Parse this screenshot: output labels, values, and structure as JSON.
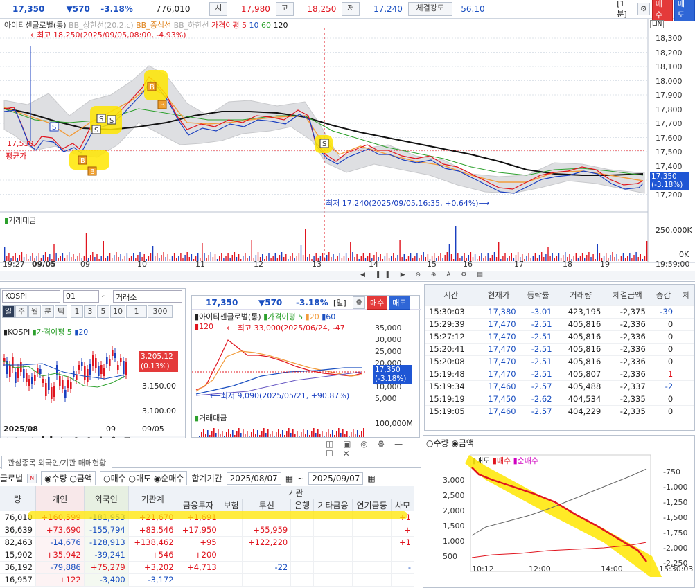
{
  "top": {
    "price": "17,350",
    "change": "▼570",
    "pct": "-3.18%",
    "volume": "776,010",
    "open_label": "시",
    "open": "17,980",
    "high_label": "고",
    "high": "18,250",
    "low_label": "저",
    "low": "17,240",
    "strength_label": "체결강도",
    "strength": "56.10",
    "period": "[1분]",
    "buy": "매수",
    "sell": "매도"
  },
  "main_chart": {
    "name": "아이티센글로벌(통)",
    "legend": [
      "BB_상한선(20,2,c)",
      "BB_중심선",
      "BB_하한선",
      "가격이평 5",
      "10",
      "60",
      "120"
    ],
    "high_note": "최고 18,250(2025/09/05,08:00, -4.93%)",
    "low_note": "최저 17,240(2025/09/05,16:35, +0.64%)",
    "avg_value": "17,530",
    "avg_label": "평균가",
    "current_price": "17,350",
    "current_pct": "(-3.18%)",
    "y_ticks": [
      "18,300",
      "18,200",
      "18,100",
      "18,000",
      "17,900",
      "17,800",
      "17,700",
      "17,600",
      "17,500",
      "17,400",
      "17,300",
      "17,200"
    ],
    "volume_label": "거래대금",
    "vol_ticks": [
      "250,000K",
      "0K"
    ],
    "x_ticks": [
      "19:27",
      "09/05",
      "09",
      "10",
      "11",
      "12",
      "13",
      "14",
      "15",
      "16",
      "17",
      "18",
      "19",
      "19:59:00"
    ],
    "toolbar_icons": [
      "scroll-left-icon",
      "pause-icon",
      "scroll-right-icon"
    ],
    "right_icons": [
      "LIN",
      "LN",
      "R"
    ]
  },
  "kospi": {
    "code": "KOSPI",
    "num": "01",
    "market": "거래소",
    "periods": [
      "일",
      "주",
      "월",
      "분",
      "틱"
    ],
    "nums": [
      "1",
      "3",
      "5",
      "10"
    ],
    "sel": "1",
    "count": "300",
    "name": "KOSPI",
    "legend": [
      "가격이평 5",
      "20"
    ],
    "value": "3,205.12",
    "pct": "(0.13%)",
    "y_ticks": [
      "3,150.00",
      "3,100.00"
    ],
    "x_labels": [
      "2025/08",
      "09",
      "09/05"
    ]
  },
  "stock_small": {
    "price": "17,350",
    "change": "▼570",
    "pct": "-3.18%",
    "period": "[일]",
    "buy": "매수",
    "sell": "매도",
    "name": "아이티센글로벌(통)",
    "legend": [
      "가격이평 5",
      "20",
      "60",
      "120"
    ],
    "high_note": "최고 33,000(2025/06/24, -47",
    "low_note": "최저 9,090(2025/05/21, +90.87%)",
    "y_ticks": [
      "35,000",
      "30,000",
      "25,000",
      "20,000",
      "15,000",
      "10,000",
      "5,000"
    ],
    "current": "17,350",
    "current_pct": "(-3.18%)",
    "volume_label": "거래대금",
    "vol_tick": "100,000M"
  },
  "ticks": {
    "headers": [
      "시간",
      "현재가",
      "등락률",
      "거래량",
      "체결금액",
      "증감",
      "체"
    ],
    "rows": [
      [
        "15:30:03",
        "17,380",
        "-3.01",
        "423,195",
        "-2,375",
        "-39"
      ],
      [
        "15:29:39",
        "17,470",
        "-2.51",
        "405,816",
        "-2,336",
        "0"
      ],
      [
        "15:27:12",
        "17,470",
        "-2.51",
        "405,816",
        "-2,336",
        "0"
      ],
      [
        "15:20:41",
        "17,470",
        "-2.51",
        "405,816",
        "-2,336",
        "0"
      ],
      [
        "15:20:08",
        "17,470",
        "-2.51",
        "405,816",
        "-2,336",
        "0"
      ],
      [
        "15:19:48",
        "17,470",
        "-2.51",
        "405,807",
        "-2,336",
        "1"
      ],
      [
        "15:19:34",
        "17,460",
        "-2.57",
        "405,488",
        "-2,337",
        "-2"
      ],
      [
        "15:19:19",
        "17,450",
        "-2.62",
        "404,534",
        "-2,335",
        "0"
      ],
      [
        "15:19:05",
        "17,460",
        "-2.57",
        "404,229",
        "-2,335",
        "0"
      ]
    ]
  },
  "investor": {
    "tab": "관심종목 외국인/기관 매매현황",
    "group_label": "글로벌",
    "radio1": [
      "수량",
      "금액"
    ],
    "radio2": [
      "매수",
      "매도",
      "순매수"
    ],
    "period_label": "합계기간",
    "date_from": "2025/08/07",
    "date_to": "2025/09/07",
    "org_header": "기관",
    "headers": [
      "량",
      "개인",
      "외국인",
      "기관계",
      "금융투자",
      "보험",
      "투신",
      "은행",
      "기타금융",
      "연기금등",
      "사모"
    ],
    "rows": [
      [
        "76,010",
        "+160,599",
        "-181,953",
        "+21,670",
        "+1,691",
        "",
        "",
        "",
        "",
        "",
        "+1"
      ],
      [
        "36,639",
        "+73,690",
        "-155,794",
        "+83,546",
        "+17,950",
        "",
        "+55,959",
        "",
        "",
        "",
        "+"
      ],
      [
        "82,463",
        "-14,676",
        "-128,913",
        "+138,462",
        "+95",
        "",
        "+122,220",
        "",
        "",
        "",
        "+1"
      ],
      [
        "15,902",
        "+35,942",
        "-39,241",
        "+546",
        "+200",
        "",
        "",
        "",
        "",
        "",
        ""
      ],
      [
        "36,192",
        "-79,886",
        "+75,279",
        "+3,202",
        "+4,713",
        "",
        "-22",
        "",
        "",
        "",
        "-"
      ],
      [
        "16,957",
        "+122",
        "-3,400",
        "-3,172",
        "",
        "",
        "",
        "",
        "",
        "",
        ""
      ]
    ]
  },
  "flow": {
    "radio": [
      "수량",
      "금액"
    ],
    "legend": [
      "매도",
      "매수",
      "순매수"
    ],
    "y_left": [
      "3,000",
      "2,500",
      "2,000",
      "1,500",
      "1,000",
      "500"
    ],
    "y_right": [
      "-750",
      "-1,000",
      "-1,250",
      "-1,500",
      "-1,750",
      "-2,000",
      "-2,250"
    ],
    "x": [
      "10:12",
      "12:00",
      "14:00",
      "15:30:03"
    ]
  },
  "colors": {
    "up": "#e0141e",
    "down": "#1a4fc0",
    "highlight": "#ffe600",
    "ma120": "#111111"
  }
}
